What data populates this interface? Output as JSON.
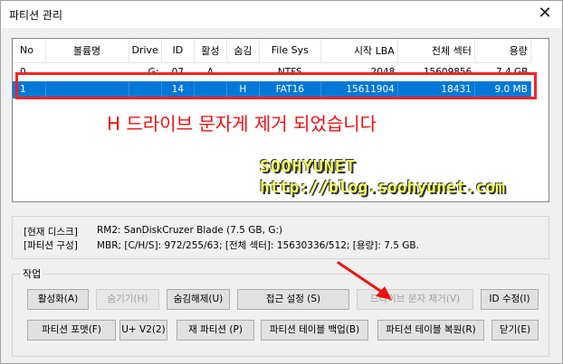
{
  "window": {
    "title": "파티션 관리",
    "close_glyph": "✕"
  },
  "table": {
    "headers": [
      "No",
      "볼륨명",
      "Drive",
      "ID",
      "활성",
      "숨김",
      "File Sys",
      "시작 LBA",
      "전체 섹터",
      "용량"
    ],
    "rows": [
      [
        "0",
        "",
        "G:",
        "07",
        "A",
        "",
        "NTFS",
        "2048",
        "15609856",
        "7.4 GB"
      ],
      [
        "1",
        "",
        "",
        "14",
        "",
        "H",
        "FAT16",
        "15611904",
        "18431",
        "9.0 MB"
      ]
    ],
    "selected_row": 1,
    "selection_color": "#0078d7"
  },
  "annotation": {
    "text": "H 드라이브 문자게 제거 되었습니다",
    "color": "#ee1111"
  },
  "watermark": {
    "line1": "SOOHYUNET",
    "line2": "http://blog.soohyunet.com"
  },
  "info": {
    "disk_label": "[현재 디스크]",
    "disk_value": "RM2: SanDiskCruzer Blade (7.5 GB, G:)",
    "part_label": "[파티션 구성]",
    "part_value": "MBR;    [C/H/S]: 972/255/63; [전체 섹터]: 15630336/512; [용량]: 7.5 GB."
  },
  "actions": {
    "group_label": "작업",
    "activate": "활성화(A)",
    "hide": "숨기기(H)",
    "unhide": "숨김해제(U)",
    "access": "접근 설정 (S)",
    "remove_letter": "드라이브 문자 제거(V)",
    "id_edit": "ID 수정(I)",
    "format": "파티션 포맷(F)",
    "uv2": "U+ V2(2)",
    "repartition": "재 파티션 (P)",
    "backup": "파티션 테이블 백업(B)",
    "restore": "파티션 테이블 복원(R)",
    "close": "닫기(E)"
  }
}
